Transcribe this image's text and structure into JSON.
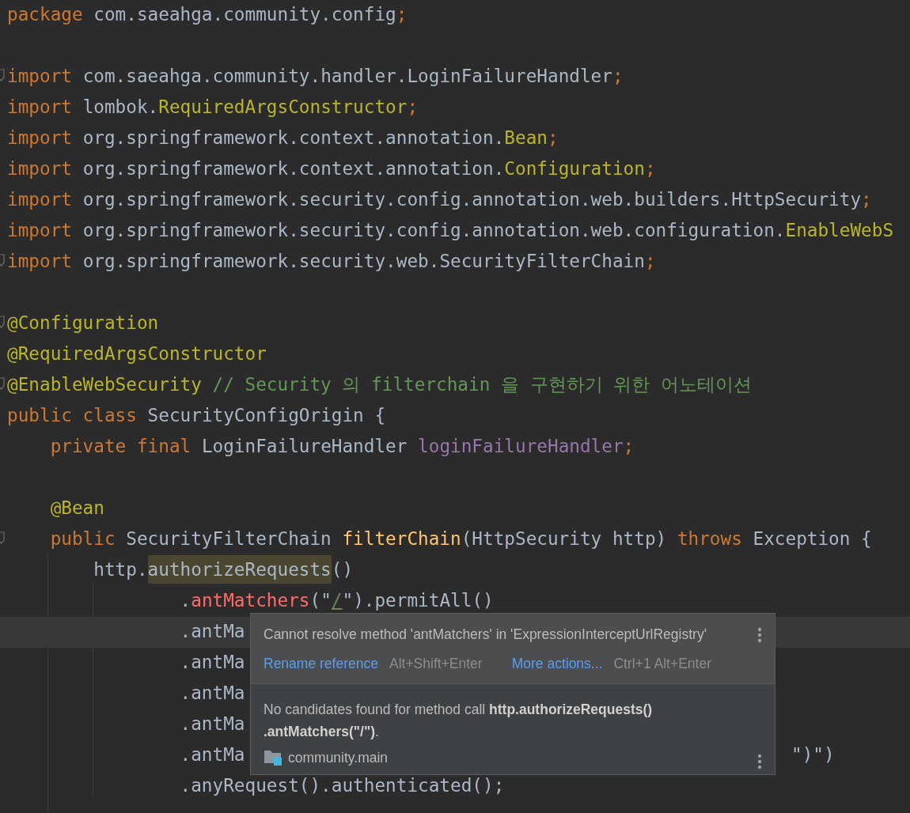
{
  "editor": {
    "lines": [
      {
        "fold": false,
        "current": false,
        "tokens": [
          {
            "kind": "keyword",
            "text": "package"
          },
          {
            "kind": "plain",
            "text": " com.saeahga.community.config"
          },
          {
            "kind": "keyword",
            "text": ";"
          }
        ]
      },
      {
        "fold": false,
        "current": false
      },
      {
        "fold": true,
        "current": false,
        "tokens": [
          {
            "kind": "keyword",
            "text": "import"
          },
          {
            "kind": "plain",
            "text": " com.saeahga.community.handler.LoginFailureHandler"
          },
          {
            "kind": "keyword",
            "text": ";"
          }
        ]
      },
      {
        "fold": false,
        "current": false,
        "tokens": [
          {
            "kind": "keyword",
            "text": "import"
          },
          {
            "kind": "plain",
            "text": " lombok."
          },
          {
            "kind": "annotation",
            "text": "RequiredArgsConstructor"
          },
          {
            "kind": "keyword",
            "text": ";"
          }
        ]
      },
      {
        "fold": false,
        "current": false,
        "tokens": [
          {
            "kind": "keyword",
            "text": "import"
          },
          {
            "kind": "plain",
            "text": " org.springframework.context.annotation."
          },
          {
            "kind": "annotation",
            "text": "Bean"
          },
          {
            "kind": "keyword",
            "text": ";"
          }
        ]
      },
      {
        "fold": false,
        "current": false,
        "tokens": [
          {
            "kind": "keyword",
            "text": "import"
          },
          {
            "kind": "plain",
            "text": " org.springframework.context.annotation."
          },
          {
            "kind": "annotation",
            "text": "Configuration"
          },
          {
            "kind": "keyword",
            "text": ";"
          }
        ]
      },
      {
        "fold": false,
        "current": false,
        "tokens": [
          {
            "kind": "keyword",
            "text": "import"
          },
          {
            "kind": "plain",
            "text": " org.springframework.security.config.annotation.web.builders.HttpSecurity"
          },
          {
            "kind": "keyword",
            "text": ";"
          }
        ]
      },
      {
        "fold": false,
        "current": false,
        "tokens": [
          {
            "kind": "keyword",
            "text": "import"
          },
          {
            "kind": "plain",
            "text": " org.springframework.security.config.annotation.web.configuration."
          },
          {
            "kind": "annotation",
            "text": "EnableWebS"
          }
        ]
      },
      {
        "fold": true,
        "current": false,
        "tokens": [
          {
            "kind": "keyword",
            "text": "import"
          },
          {
            "kind": "plain",
            "text": " org.springframework.security.web.SecurityFilterChain"
          },
          {
            "kind": "keyword",
            "text": ";"
          }
        ]
      },
      {
        "fold": false,
        "current": false
      },
      {
        "fold": true,
        "current": false,
        "tokens": [
          {
            "kind": "annotation",
            "text": "@Configuration"
          }
        ]
      },
      {
        "fold": false,
        "current": false,
        "tokens": [
          {
            "kind": "annotation",
            "text": "@RequiredArgsConstructor"
          }
        ]
      },
      {
        "fold": true,
        "current": false,
        "tokens": [
          {
            "kind": "annotation",
            "text": "@EnableWebSecurity"
          },
          {
            "kind": "comment",
            "text": " // Security 의 filterchain 을 구현하기 위한 어노테이션"
          }
        ]
      },
      {
        "fold": false,
        "current": false,
        "tokens": [
          {
            "kind": "keyword",
            "text": "public class"
          },
          {
            "kind": "plain",
            "text": " SecurityConfigOrigin {"
          }
        ]
      },
      {
        "fold": false,
        "current": false,
        "tokens": [
          {
            "kind": "keyword",
            "text": "    private final"
          },
          {
            "kind": "plain",
            "text": " LoginFailureHandler "
          },
          {
            "kind": "field",
            "text": "loginFailureHandler"
          },
          {
            "kind": "keyword",
            "text": ";"
          }
        ]
      },
      {
        "fold": false,
        "current": false
      },
      {
        "fold": false,
        "current": false,
        "tokens": [
          {
            "kind": "annotation",
            "text": "    @Bean"
          }
        ]
      },
      {
        "fold": true,
        "current": false,
        "tokens": [
          {
            "kind": "keyword",
            "text": "    public"
          },
          {
            "kind": "plain",
            "text": " SecurityFilterChain "
          },
          {
            "kind": "method",
            "text": "filterChain"
          },
          {
            "kind": "plain",
            "text": "(HttpSecurity http) "
          },
          {
            "kind": "keyword",
            "text": "throws"
          },
          {
            "kind": "plain",
            "text": " Exception {"
          }
        ]
      },
      {
        "fold": false,
        "current": false,
        "tokens": [
          {
            "kind": "plain",
            "text": "        http."
          },
          {
            "kind": "highlight",
            "text": "authorizeRequests"
          },
          {
            "kind": "plain",
            "text": "()"
          }
        ]
      },
      {
        "fold": false,
        "current": false,
        "tokens": [
          {
            "kind": "plain",
            "text": "                ."
          },
          {
            "kind": "error",
            "text": "antMatchers"
          },
          {
            "kind": "plain",
            "text": "(\""
          },
          {
            "kind": "string",
            "text": "/"
          },
          {
            "kind": "plain",
            "text": "\").permitAll()"
          }
        ]
      },
      {
        "fold": false,
        "current": true,
        "tokens": [
          {
            "kind": "plain",
            "text": "                .antMa"
          }
        ]
      },
      {
        "fold": false,
        "current": false,
        "tokens": [
          {
            "kind": "plain",
            "text": "                .antMa"
          }
        ]
      },
      {
        "fold": false,
        "current": false,
        "tokens": [
          {
            "kind": "plain",
            "text": "                .antMa"
          }
        ]
      },
      {
        "fold": false,
        "current": false,
        "tokens": [
          {
            "kind": "plain",
            "text": "                .antMa"
          }
        ]
      },
      {
        "fold": false,
        "current": false,
        "tokens": [
          {
            "kind": "plain",
            "text": "                .antMa"
          }
        ],
        "tail": "\")\")"
      },
      {
        "fold": false,
        "current": false,
        "tokens": [
          {
            "kind": "plain",
            "text": "                .anyRequest().authenticated();"
          }
        ]
      }
    ]
  },
  "popup": {
    "message": "Cannot resolve method 'antMatchers' in 'ExpressionInterceptUrlRegistry'",
    "actions": [
      {
        "label": "Rename reference",
        "shortcut": "Alt+Shift+Enter"
      },
      {
        "label": "More actions...",
        "shortcut": "Ctrl+1 Alt+Enter"
      }
    ],
    "detail": "No candidates found for method call **http.authorizeRequests()** **.antMatchers(\"/\")**.",
    "module": "community.main"
  }
}
